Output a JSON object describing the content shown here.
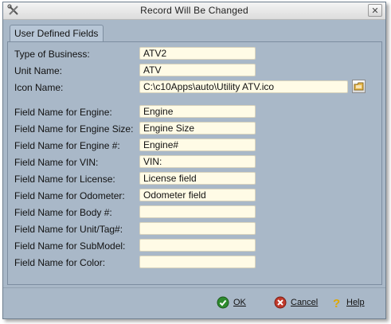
{
  "window": {
    "title": "Record Will Be Changed"
  },
  "tab": {
    "label": "User Defined Fields"
  },
  "basic_fields": [
    {
      "label": "Type of Business:",
      "value": "ATV2"
    },
    {
      "label": "Unit Name:",
      "value": "ATV"
    },
    {
      "label": "Icon Name:",
      "value": "C:\\c10Apps\\auto\\Utility ATV.ico"
    }
  ],
  "name_fields": [
    {
      "label": "Field Name for Engine:",
      "value": "Engine"
    },
    {
      "label": "Field Name for Engine Size:",
      "value": "Engine Size"
    },
    {
      "label": "Field Name for Engine #:",
      "value": "Engine#"
    },
    {
      "label": "Field Name for VIN:",
      "value": "VIN:"
    },
    {
      "label": "Field Name for License:",
      "value": "License field"
    },
    {
      "label": "Field Name for Odometer:",
      "value": "Odometer field"
    },
    {
      "label": "Field Name for Body #:",
      "value": ""
    },
    {
      "label": "Field Name for Unit/Tag#:",
      "value": ""
    },
    {
      "label": "Field Name for SubModel:",
      "value": ""
    },
    {
      "label": "Field Name for Color:",
      "value": ""
    }
  ],
  "footer": {
    "ok_label": "OK",
    "cancel_label": "Cancel",
    "help_label": "Help"
  },
  "colors": {
    "dialog_background": "#a9b8c8",
    "field_background": "#fffbe6",
    "ok_icon": "#2e8b2e",
    "cancel_icon": "#c0392b",
    "help_icon": "#e0a800"
  }
}
